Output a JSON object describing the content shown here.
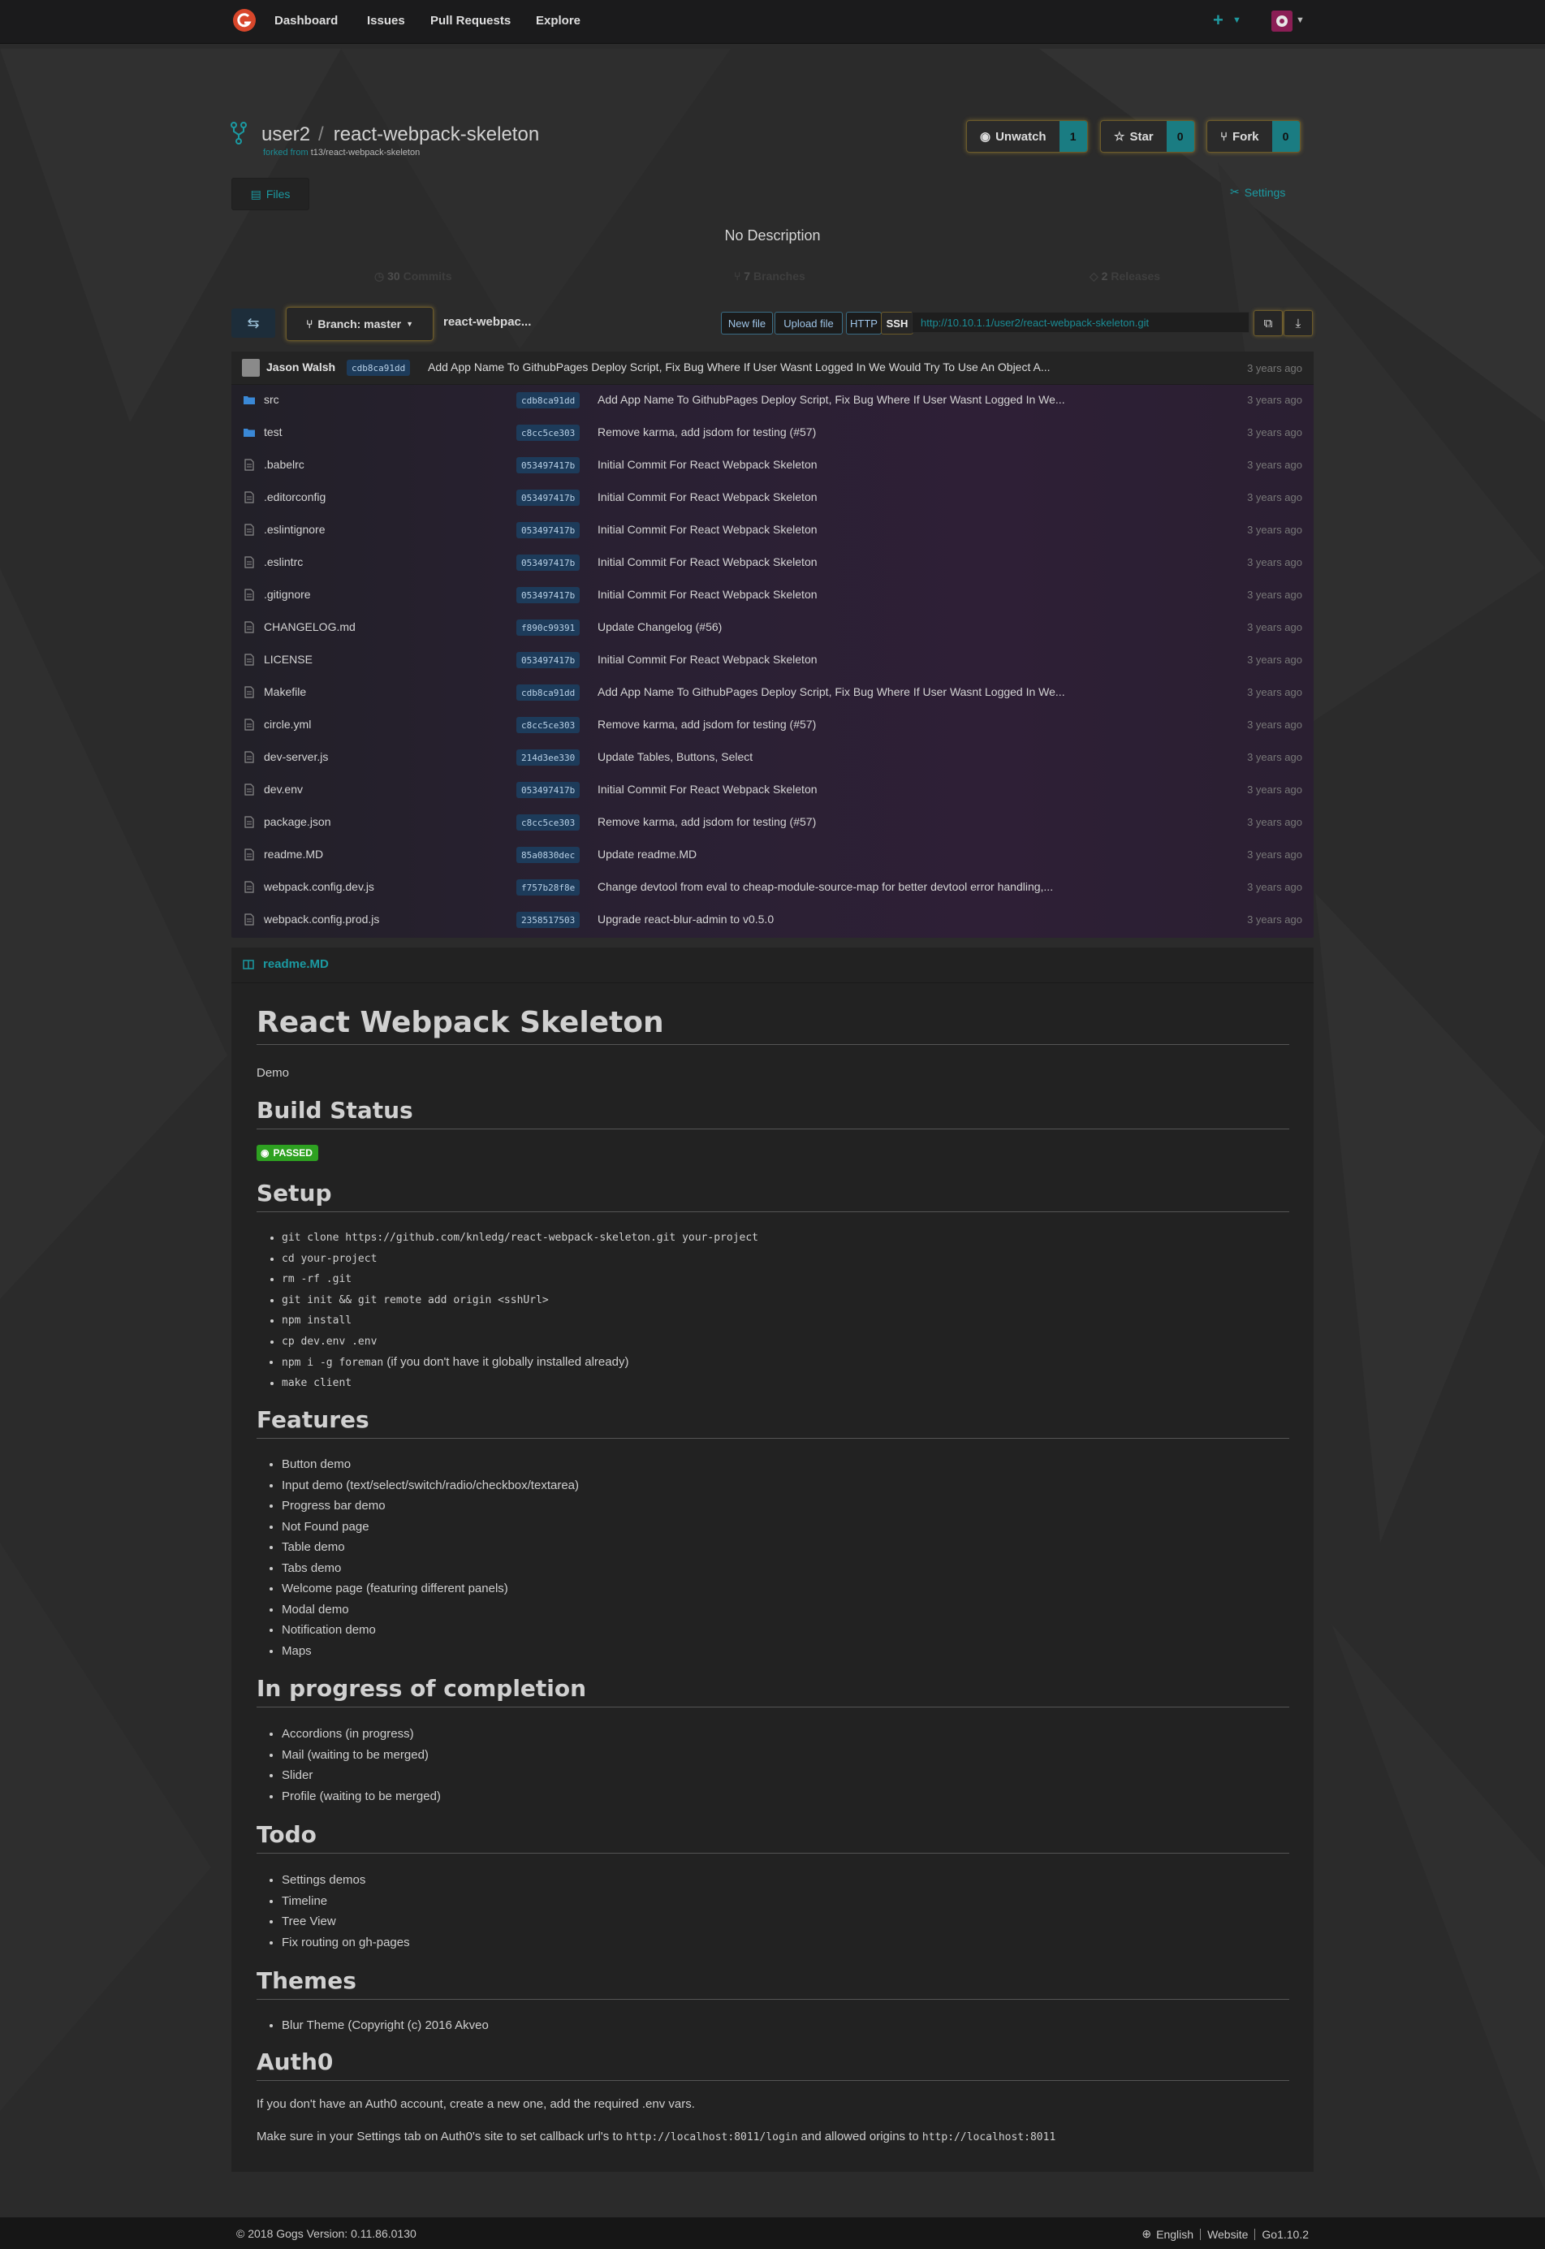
{
  "nav": {
    "dashboard": "Dashboard",
    "issues": "Issues",
    "pull_requests": "Pull Requests",
    "explore": "Explore",
    "new_symbol": "+"
  },
  "repo": {
    "owner": "user2",
    "name": "react-webpack-skeleton",
    "forked_prefix": "forked from",
    "forked_source": "t13/react-webpack-skeleton",
    "watch_label": "Unwatch",
    "watch_count": "1",
    "star_label": "Star",
    "star_count": "0",
    "fork_label": "Fork",
    "fork_count": "0",
    "files_tab": "Files",
    "settings_label": "Settings",
    "description": "No Description",
    "commits_num": "30",
    "commits_label": "Commits",
    "branches_num": "7",
    "branches_label": "Branches",
    "releases_num": "2",
    "releases_label": "Releases"
  },
  "toolbar": {
    "branch_label": "Branch: master",
    "breadcrumb": "react-webpac...",
    "new_file": "New file",
    "upload_file": "Upload file",
    "http": "HTTP",
    "ssh": "SSH",
    "clone_url": "http://10.10.1.1/user2/react-webpack-skeleton.git"
  },
  "latest_commit": {
    "author": "Jason Walsh",
    "sha": "cdb8ca91dd",
    "message": "Add App Name To GithubPages Deploy Script, Fix Bug Where If User Wasnt Logged In We Would Try To Use An Object A...",
    "time": "3 years ago"
  },
  "files": [
    {
      "name": "src",
      "type": "dir",
      "sha": "cdb8ca91dd",
      "message": "Add App Name To GithubPages Deploy Script, Fix Bug Where If User Wasnt Logged In We...",
      "time": "3 years ago"
    },
    {
      "name": "test",
      "type": "dir",
      "sha": "c8cc5ce303",
      "message": "Remove karma, add jsdom for testing (#57)",
      "time": "3 years ago"
    },
    {
      "name": ".babelrc",
      "type": "file",
      "sha": "053497417b",
      "message": "Initial Commit For React Webpack Skeleton",
      "time": "3 years ago"
    },
    {
      "name": ".editorconfig",
      "type": "file",
      "sha": "053497417b",
      "message": "Initial Commit For React Webpack Skeleton",
      "time": "3 years ago"
    },
    {
      "name": ".eslintignore",
      "type": "file",
      "sha": "053497417b",
      "message": "Initial Commit For React Webpack Skeleton",
      "time": "3 years ago"
    },
    {
      "name": ".eslintrc",
      "type": "file",
      "sha": "053497417b",
      "message": "Initial Commit For React Webpack Skeleton",
      "time": "3 years ago"
    },
    {
      "name": ".gitignore",
      "type": "file",
      "sha": "053497417b",
      "message": "Initial Commit For React Webpack Skeleton",
      "time": "3 years ago"
    },
    {
      "name": "CHANGELOG.md",
      "type": "file",
      "sha": "f890c99391",
      "message": "Update Changelog (#56)",
      "time": "3 years ago"
    },
    {
      "name": "LICENSE",
      "type": "file",
      "sha": "053497417b",
      "message": "Initial Commit For React Webpack Skeleton",
      "time": "3 years ago"
    },
    {
      "name": "Makefile",
      "type": "file",
      "sha": "cdb8ca91dd",
      "message": "Add App Name To GithubPages Deploy Script, Fix Bug Where If User Wasnt Logged In We...",
      "time": "3 years ago"
    },
    {
      "name": "circle.yml",
      "type": "file",
      "sha": "c8cc5ce303",
      "message": "Remove karma, add jsdom for testing (#57)",
      "time": "3 years ago"
    },
    {
      "name": "dev-server.js",
      "type": "file",
      "sha": "214d3ee330",
      "message": "Update Tables, Buttons, Select",
      "time": "3 years ago"
    },
    {
      "name": "dev.env",
      "type": "file",
      "sha": "053497417b",
      "message": "Initial Commit For React Webpack Skeleton",
      "time": "3 years ago"
    },
    {
      "name": "package.json",
      "type": "file",
      "sha": "c8cc5ce303",
      "message": "Remove karma, add jsdom for testing (#57)",
      "time": "3 years ago"
    },
    {
      "name": "readme.MD",
      "type": "file",
      "sha": "85a0830dec",
      "message": "Update readme.MD",
      "time": "3 years ago"
    },
    {
      "name": "webpack.config.dev.js",
      "type": "file",
      "sha": "f757b28f8e",
      "message": "Change devtool from eval to cheap-module-source-map for better devtool error handling,...",
      "time": "3 years ago"
    },
    {
      "name": "webpack.config.prod.js",
      "type": "file",
      "sha": "2358517503",
      "message": "Upgrade react-blur-admin to v0.5.0",
      "time": "3 years ago"
    }
  ],
  "readme": {
    "filename": "readme.MD",
    "title": "React Webpack Skeleton",
    "demo": "Demo",
    "build_status_heading": "Build Status",
    "badge_text": "PASSED",
    "setup_heading": "Setup",
    "setup_steps": [
      "git clone https://github.com/knledg/react-webpack-skeleton.git your-project",
      "cd your-project",
      "rm -rf .git",
      "git init && git remote add origin <sshUrl>",
      "npm install",
      "cp dev.env .env"
    ],
    "setup_step7_code": "npm i -g foreman",
    "setup_step7_text": "(if you don't have it globally installed already)",
    "setup_step8": "make client",
    "features_heading": "Features",
    "features": [
      "Button demo",
      "Input demo (text/select/switch/radio/checkbox/textarea)",
      "Progress bar demo",
      "Not Found page",
      "Table demo",
      "Tabs demo",
      "Welcome page (featuring different panels)",
      "Modal demo",
      "Notification demo",
      "Maps"
    ],
    "progress_heading": "In progress of completion",
    "progress": [
      "Accordions (in progress)",
      "Mail (waiting to be merged)",
      "Slider",
      "Profile (waiting to be merged)"
    ],
    "todo_heading": "Todo",
    "todo": [
      "Settings demos",
      "Timeline",
      "Tree View",
      "Fix routing on gh-pages"
    ],
    "themes_heading": "Themes",
    "themes": [
      "Blur Theme (Copyright (c) 2016 Akveo"
    ],
    "auth_heading": "Auth0",
    "auth_p1": "If you don't have an Auth0 account, create a new one, add the required .env vars.",
    "auth_p2_a": "Make sure in your Settings tab on Auth0's site to set callback url's to",
    "auth_p2_code1": "http://localhost:8011/login",
    "auth_p2_b": "and allowed origins to",
    "auth_p2_code2": "http://localhost:8011"
  },
  "footer": {
    "copyright": "© 2018 Gogs Version: 0.11.86.0130",
    "language": "English",
    "website": "Website",
    "go_version": "Go1.10.2"
  },
  "colors": {
    "accent": "#1b9aa2",
    "badge_green": "#2ea121",
    "sha_bg": "#1d3b5a",
    "glow": "#d2aa3c"
  }
}
